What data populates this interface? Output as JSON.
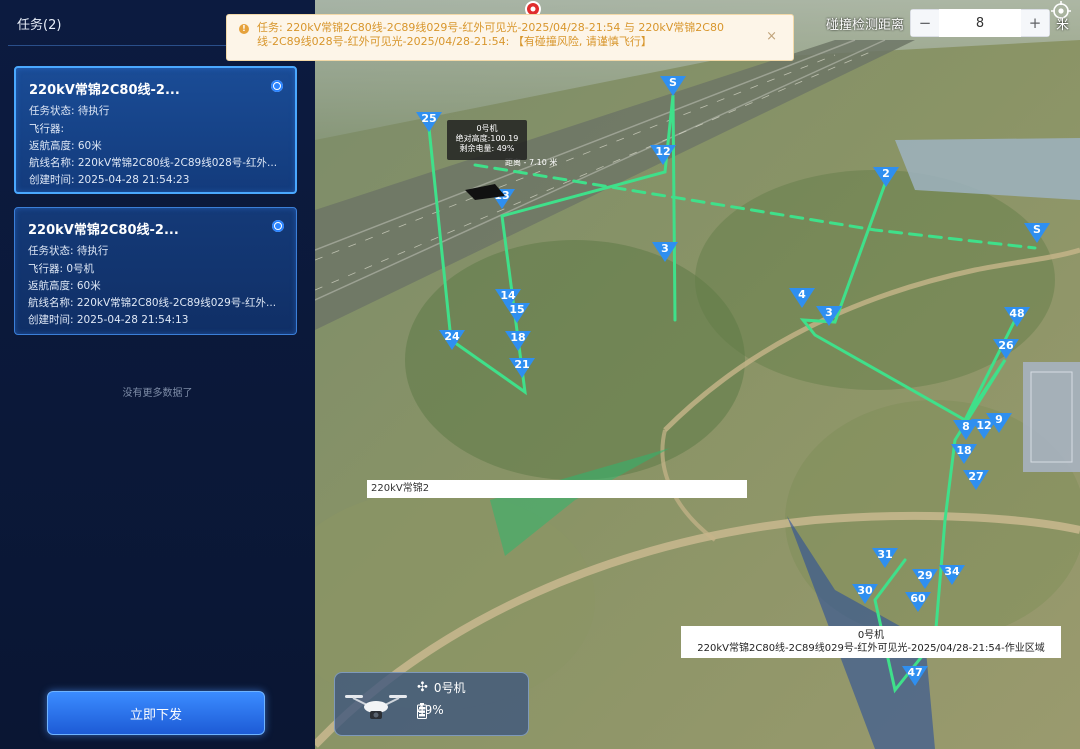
{
  "panel": {
    "title": "任务(2)",
    "tasks": [
      {
        "title": "220kV常锦2C80线-2...",
        "status": "任务状态: 待执行",
        "aircraft": "飞行器: ",
        "return_height": "返航高度: 60米",
        "route": "航线名称: 220kV常锦2C80线-2C89线028号-红外...",
        "created": "创建时间: 2025-04-28 21:54:23"
      },
      {
        "title": "220kV常锦2C80线-2...",
        "status": "任务状态: 待执行",
        "aircraft": "飞行器: 0号机",
        "return_height": "返航高度: 60米",
        "route": "航线名称: 220kV常锦2C80线-2C89线029号-红外...",
        "created": "创建时间: 2025-04-28 21:54:13"
      }
    ],
    "no_more": "没有更多数据了",
    "submit_label": "立即下发"
  },
  "warning": {
    "icon": "warning-icon",
    "text": "任务: 220kV常锦2C80线-2C89线029号-红外可见光-2025/04/28-21:54 与 220kV常锦2C80线-2C89线028号-红外可见光-2025/04/28-21:54: 【有碰撞风险, 请谨慎飞行】",
    "close": "×"
  },
  "collision": {
    "label": "碰撞检测距离",
    "minus": "−",
    "value": "8",
    "plus": "+",
    "unit": "米"
  },
  "drone_tooltip": {
    "name": "0号机",
    "altitude": "绝对高度:100.19",
    "battery": "剩余电量: 49%"
  },
  "distance_label": "距离 - 7.10 米",
  "map_labels": {
    "line_name": "220kV常锦2",
    "area_name": "0号机",
    "area_desc": "220kV常锦2C80线-2C89线029号-红外可见光-2025/04/28-21:54-作业区域"
  },
  "drone_card": {
    "name": "0号机",
    "battery": "49%",
    "drone_icon": "drone-icon",
    "battery_icon": "battery-icon"
  },
  "waypoints": [
    "S",
    "25",
    "12",
    "13",
    "14",
    "15",
    "18",
    "21",
    "24",
    "3",
    "2",
    "S",
    "4",
    "3",
    "48",
    "26",
    "8",
    "12",
    "9",
    "18",
    "27",
    "31",
    "30",
    "29",
    "34",
    "60",
    "47"
  ],
  "colors": {
    "route": "#3fe08a",
    "waypoint": "#2f8ff0",
    "warning_text": "#d8962c",
    "card_border": "#3b7fd8",
    "accent": "#2b84ff"
  }
}
